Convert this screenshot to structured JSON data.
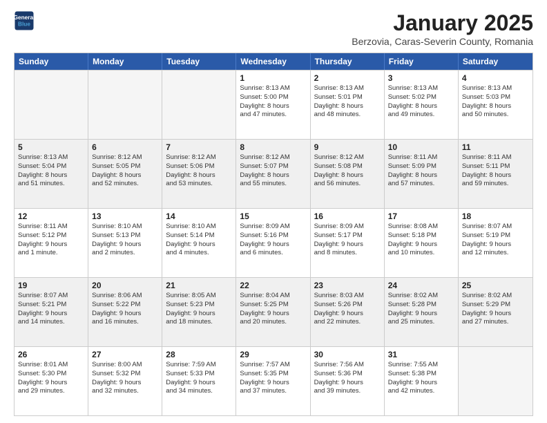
{
  "logo": {
    "line1": "General",
    "line2": "Blue"
  },
  "title": "January 2025",
  "subtitle": "Berzovia, Caras-Severin County, Romania",
  "days": [
    "Sunday",
    "Monday",
    "Tuesday",
    "Wednesday",
    "Thursday",
    "Friday",
    "Saturday"
  ],
  "weeks": [
    [
      {
        "day": "",
        "empty": true
      },
      {
        "day": "",
        "empty": true
      },
      {
        "day": "",
        "empty": true
      },
      {
        "day": "1",
        "line1": "Sunrise: 8:13 AM",
        "line2": "Sunset: 5:00 PM",
        "line3": "Daylight: 8 hours",
        "line4": "and 47 minutes."
      },
      {
        "day": "2",
        "line1": "Sunrise: 8:13 AM",
        "line2": "Sunset: 5:01 PM",
        "line3": "Daylight: 8 hours",
        "line4": "and 48 minutes."
      },
      {
        "day": "3",
        "line1": "Sunrise: 8:13 AM",
        "line2": "Sunset: 5:02 PM",
        "line3": "Daylight: 8 hours",
        "line4": "and 49 minutes."
      },
      {
        "day": "4",
        "line1": "Sunrise: 8:13 AM",
        "line2": "Sunset: 5:03 PM",
        "line3": "Daylight: 8 hours",
        "line4": "and 50 minutes."
      }
    ],
    [
      {
        "day": "5",
        "line1": "Sunrise: 8:13 AM",
        "line2": "Sunset: 5:04 PM",
        "line3": "Daylight: 8 hours",
        "line4": "and 51 minutes."
      },
      {
        "day": "6",
        "line1": "Sunrise: 8:12 AM",
        "line2": "Sunset: 5:05 PM",
        "line3": "Daylight: 8 hours",
        "line4": "and 52 minutes."
      },
      {
        "day": "7",
        "line1": "Sunrise: 8:12 AM",
        "line2": "Sunset: 5:06 PM",
        "line3": "Daylight: 8 hours",
        "line4": "and 53 minutes."
      },
      {
        "day": "8",
        "line1": "Sunrise: 8:12 AM",
        "line2": "Sunset: 5:07 PM",
        "line3": "Daylight: 8 hours",
        "line4": "and 55 minutes."
      },
      {
        "day": "9",
        "line1": "Sunrise: 8:12 AM",
        "line2": "Sunset: 5:08 PM",
        "line3": "Daylight: 8 hours",
        "line4": "and 56 minutes."
      },
      {
        "day": "10",
        "line1": "Sunrise: 8:11 AM",
        "line2": "Sunset: 5:09 PM",
        "line3": "Daylight: 8 hours",
        "line4": "and 57 minutes."
      },
      {
        "day": "11",
        "line1": "Sunrise: 8:11 AM",
        "line2": "Sunset: 5:11 PM",
        "line3": "Daylight: 8 hours",
        "line4": "and 59 minutes."
      }
    ],
    [
      {
        "day": "12",
        "line1": "Sunrise: 8:11 AM",
        "line2": "Sunset: 5:12 PM",
        "line3": "Daylight: 9 hours",
        "line4": "and 1 minute."
      },
      {
        "day": "13",
        "line1": "Sunrise: 8:10 AM",
        "line2": "Sunset: 5:13 PM",
        "line3": "Daylight: 9 hours",
        "line4": "and 2 minutes."
      },
      {
        "day": "14",
        "line1": "Sunrise: 8:10 AM",
        "line2": "Sunset: 5:14 PM",
        "line3": "Daylight: 9 hours",
        "line4": "and 4 minutes."
      },
      {
        "day": "15",
        "line1": "Sunrise: 8:09 AM",
        "line2": "Sunset: 5:16 PM",
        "line3": "Daylight: 9 hours",
        "line4": "and 6 minutes."
      },
      {
        "day": "16",
        "line1": "Sunrise: 8:09 AM",
        "line2": "Sunset: 5:17 PM",
        "line3": "Daylight: 9 hours",
        "line4": "and 8 minutes."
      },
      {
        "day": "17",
        "line1": "Sunrise: 8:08 AM",
        "line2": "Sunset: 5:18 PM",
        "line3": "Daylight: 9 hours",
        "line4": "and 10 minutes."
      },
      {
        "day": "18",
        "line1": "Sunrise: 8:07 AM",
        "line2": "Sunset: 5:19 PM",
        "line3": "Daylight: 9 hours",
        "line4": "and 12 minutes."
      }
    ],
    [
      {
        "day": "19",
        "line1": "Sunrise: 8:07 AM",
        "line2": "Sunset: 5:21 PM",
        "line3": "Daylight: 9 hours",
        "line4": "and 14 minutes."
      },
      {
        "day": "20",
        "line1": "Sunrise: 8:06 AM",
        "line2": "Sunset: 5:22 PM",
        "line3": "Daylight: 9 hours",
        "line4": "and 16 minutes."
      },
      {
        "day": "21",
        "line1": "Sunrise: 8:05 AM",
        "line2": "Sunset: 5:23 PM",
        "line3": "Daylight: 9 hours",
        "line4": "and 18 minutes."
      },
      {
        "day": "22",
        "line1": "Sunrise: 8:04 AM",
        "line2": "Sunset: 5:25 PM",
        "line3": "Daylight: 9 hours",
        "line4": "and 20 minutes."
      },
      {
        "day": "23",
        "line1": "Sunrise: 8:03 AM",
        "line2": "Sunset: 5:26 PM",
        "line3": "Daylight: 9 hours",
        "line4": "and 22 minutes."
      },
      {
        "day": "24",
        "line1": "Sunrise: 8:02 AM",
        "line2": "Sunset: 5:28 PM",
        "line3": "Daylight: 9 hours",
        "line4": "and 25 minutes."
      },
      {
        "day": "25",
        "line1": "Sunrise: 8:02 AM",
        "line2": "Sunset: 5:29 PM",
        "line3": "Daylight: 9 hours",
        "line4": "and 27 minutes."
      }
    ],
    [
      {
        "day": "26",
        "line1": "Sunrise: 8:01 AM",
        "line2": "Sunset: 5:30 PM",
        "line3": "Daylight: 9 hours",
        "line4": "and 29 minutes."
      },
      {
        "day": "27",
        "line1": "Sunrise: 8:00 AM",
        "line2": "Sunset: 5:32 PM",
        "line3": "Daylight: 9 hours",
        "line4": "and 32 minutes."
      },
      {
        "day": "28",
        "line1": "Sunrise: 7:59 AM",
        "line2": "Sunset: 5:33 PM",
        "line3": "Daylight: 9 hours",
        "line4": "and 34 minutes."
      },
      {
        "day": "29",
        "line1": "Sunrise: 7:57 AM",
        "line2": "Sunset: 5:35 PM",
        "line3": "Daylight: 9 hours",
        "line4": "and 37 minutes."
      },
      {
        "day": "30",
        "line1": "Sunrise: 7:56 AM",
        "line2": "Sunset: 5:36 PM",
        "line3": "Daylight: 9 hours",
        "line4": "and 39 minutes."
      },
      {
        "day": "31",
        "line1": "Sunrise: 7:55 AM",
        "line2": "Sunset: 5:38 PM",
        "line3": "Daylight: 9 hours",
        "line4": "and 42 minutes."
      },
      {
        "day": "",
        "empty": true
      }
    ]
  ]
}
